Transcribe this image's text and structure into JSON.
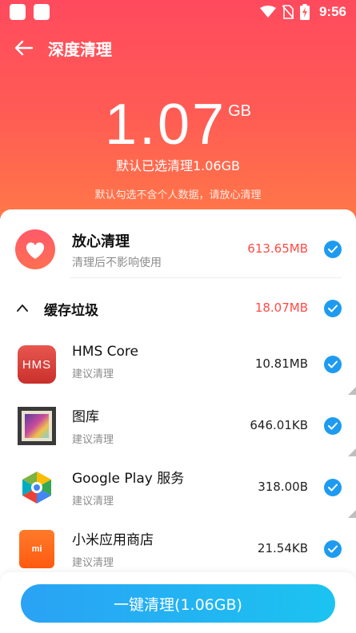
{
  "status_bar": {
    "time": "9:56",
    "icons": [
      "wifi-icon",
      "no-sim-icon",
      "battery-charging-icon"
    ]
  },
  "header": {
    "title": "深度清理",
    "back_icon": "arrow-left-icon"
  },
  "summary": {
    "size_value": "1.07",
    "size_unit": "GB",
    "selected_text": "默认已选清理1.06GB",
    "hint": "默认勾选不含个人数据，请放心清理"
  },
  "safe_clean": {
    "title": "放心清理",
    "subtitle": "清理后不影响使用",
    "size": "613.65MB",
    "icon": "heart-icon",
    "checked": true
  },
  "cache_section": {
    "title": "缓存垃圾",
    "size": "18.07MB",
    "expanded": true,
    "checked": true,
    "items": [
      {
        "name": "HMS Core",
        "sub": "建议清理",
        "size": "10.81MB",
        "icon": "hms-core-icon",
        "checked": true
      },
      {
        "name": "图库",
        "sub": "建议清理",
        "size": "646.01KB",
        "icon": "gallery-icon",
        "checked": true
      },
      {
        "name": "Google Play 服务",
        "sub": "建议清理",
        "size": "318.00B",
        "icon": "google-play-services-icon",
        "checked": true
      },
      {
        "name": "小米应用商店",
        "sub": "建议清理",
        "size": "21.54KB",
        "icon": "mi-app-store-icon",
        "checked": true
      }
    ]
  },
  "bottom": {
    "button_label": "一键清理(1.06GB)"
  },
  "colors": {
    "hero_top": "#ff4a5e",
    "hero_bottom": "#ff7d45",
    "accent_blue": "#1e9bf0",
    "size_red": "#ff4a45"
  },
  "hms_icon_text": "HMS",
  "mi_icon_text": "mi"
}
